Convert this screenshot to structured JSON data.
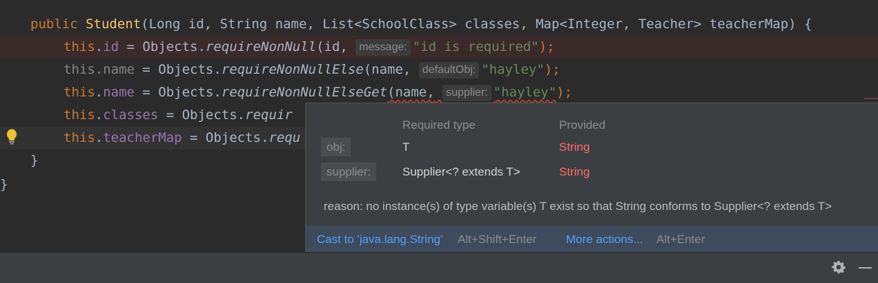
{
  "editor": {
    "line1": {
      "kw": "public",
      "fn": "Student",
      "rest": "(Long id, String name, List<SchoolClass> classes, Map<Integer, Teacher> teacherMap) {"
    },
    "line2": {
      "this": "this",
      "field": "id",
      "assign": " = Objects.",
      "method": "requireNonNull",
      "arg": "(id,",
      "hint": "message:",
      "str": "\"id is required\"",
      "end": ");"
    },
    "line3": {
      "this": "this",
      "field": "name",
      "assign": " = Objects.",
      "method": "requireNonNullElse",
      "arg": "(name,",
      "hint": "defaultObj:",
      "str": "\"hayley\"",
      "end": ");"
    },
    "line4": {
      "this": "this",
      "field": "name",
      "assign": " = Objects.",
      "method": "requireNonNullElseGet",
      "arg": "(name,",
      "hint": "supplier:",
      "str": "\"hayley\"",
      "end": ");"
    },
    "line5": {
      "this": "this",
      "field": "classes",
      "assign": " = Objects.",
      "method": "requir"
    },
    "line6": {
      "this": "this",
      "field": "teacherMap",
      "assign": " = Objects.",
      "method": "requ"
    },
    "line7": {
      "text": "}"
    },
    "line8": {
      "text": "}"
    }
  },
  "popup": {
    "header_required": "Required type",
    "header_provided": "Provided",
    "rows": [
      {
        "param": "obj:",
        "required": "T",
        "provided": "String"
      },
      {
        "param": "supplier:",
        "required": "Supplier<? extends T>",
        "provided": "String"
      }
    ],
    "reason": "reason: no instance(s) of type variable(s) T exist so that String conforms to Supplier<? extends T>",
    "actions": {
      "cast_label": "Cast to 'java.lang.String'",
      "cast_shortcut": "Alt+Shift+Enter",
      "more_label": "More actions...",
      "more_shortcut": "Alt+Enter"
    }
  },
  "colors": {
    "editor_bg": "#2b2b2b",
    "keyword": "#cc7832",
    "field": "#9876aa",
    "string": "#6a8759",
    "error": "#ff6b68",
    "link": "#589df6"
  },
  "icons": {
    "bulb": "lightbulb-icon",
    "gear": "gear-icon",
    "minimize": "minimize-icon"
  }
}
